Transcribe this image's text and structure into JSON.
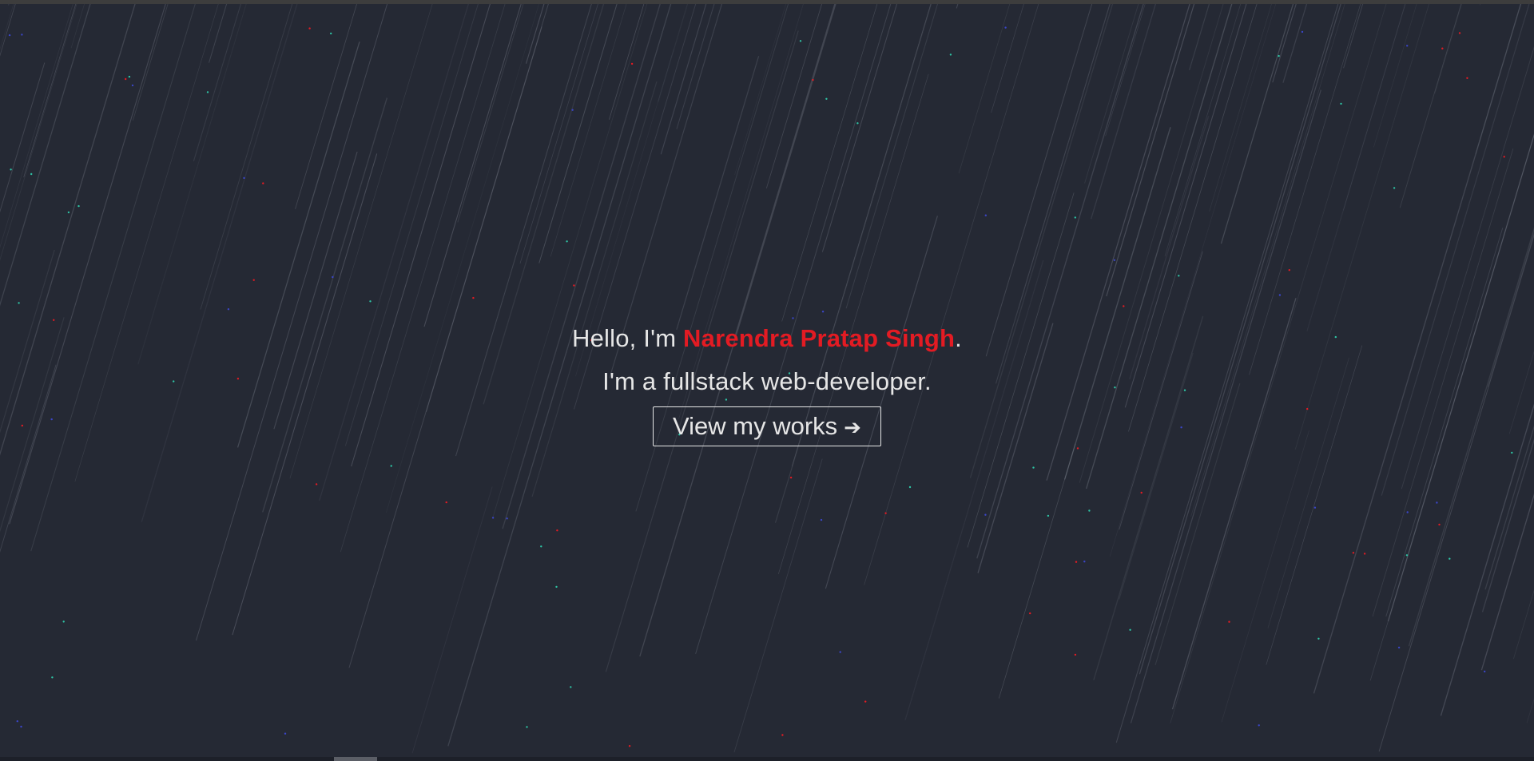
{
  "hero": {
    "greeting_prefix": "Hello, I'm ",
    "name": "Narendra Pratap Singh",
    "greeting_suffix": ".",
    "tagline": "I'm a fullstack web-developer.",
    "cta_label": "View my works",
    "cta_icon": "arrow-right-icon",
    "cta_icon_glyph": "➔"
  },
  "colors": {
    "background": "#252934",
    "accent": "#e31b23",
    "text": "#e6e6e6",
    "star_red": "#e31b23",
    "star_teal": "#2ec4a5",
    "star_blue": "#3b46c8"
  }
}
